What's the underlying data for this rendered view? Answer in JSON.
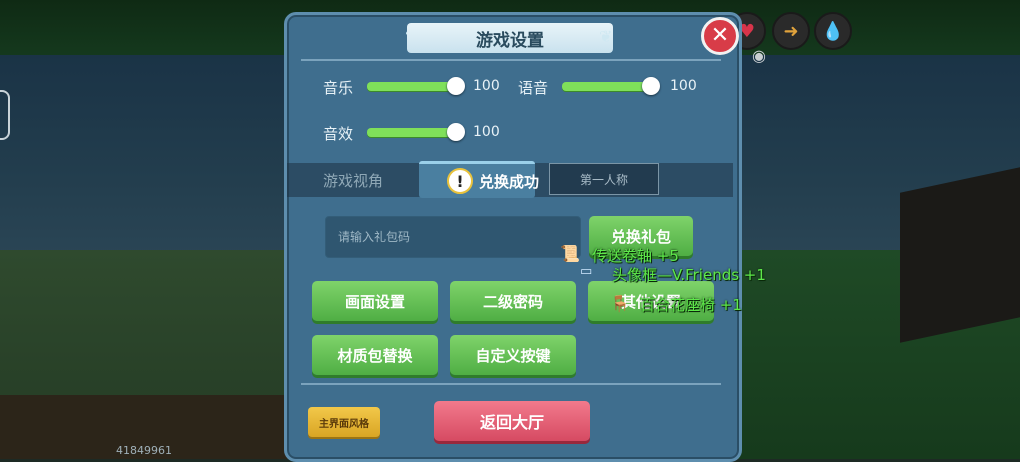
{
  "hud": {
    "heart_icon": "heart-icon",
    "food_icon": "drumstick-icon",
    "water_icon": "water-drop-icon",
    "eye_icon": "eye-icon"
  },
  "player_id": "41849961",
  "settings": {
    "title": "游戏设置",
    "close_icon": "close-icon",
    "music": {
      "label": "音乐",
      "value": "100",
      "level": 100
    },
    "voice": {
      "label": "语音",
      "value": "100",
      "level": 100
    },
    "sfx": {
      "label": "音效",
      "value": "100",
      "level": 100
    },
    "view": {
      "label": "游戏视角",
      "option_first": "第一人称"
    },
    "toast": "兑换成功",
    "gift": {
      "placeholder": "请输入礼包码",
      "redeem_label": "兑换礼包"
    },
    "buttons": {
      "graphics": "画面设置",
      "password": "二级密码",
      "other": "其他设置",
      "texture": "材质包替换",
      "keys": "自定义按键"
    },
    "style_label": "主界面风格",
    "lobby_label": "返回大厅"
  },
  "rewards": [
    {
      "text": "传送卷轴 +5"
    },
    {
      "text": "头像框—V.Friends +1"
    },
    {
      "text": "百合花座椅 +1"
    }
  ],
  "colors": {
    "panel": "#3f6e8e",
    "green_button": "#5fc24f",
    "red_button": "#d64a62",
    "yellow_button": "#e8b83a",
    "reward_text": "#5ee84a"
  }
}
